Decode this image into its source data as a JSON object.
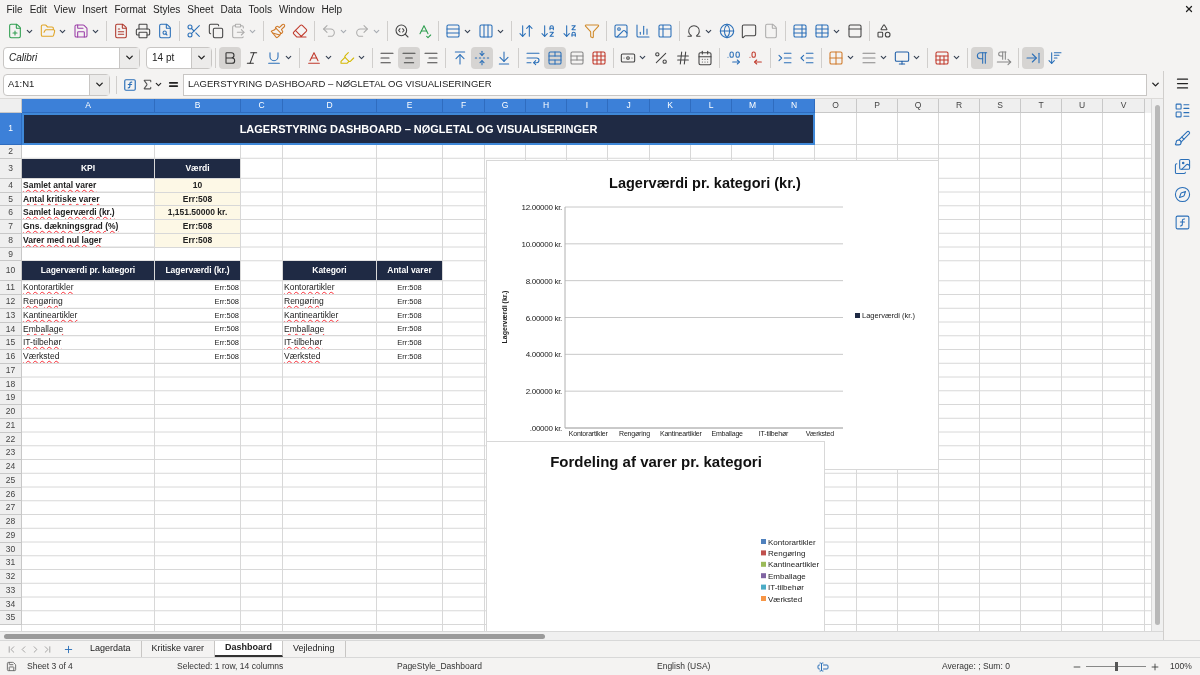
{
  "menu": [
    "File",
    "Edit",
    "View",
    "Insert",
    "Format",
    "Styles",
    "Sheet",
    "Data",
    "Tools",
    "Window",
    "Help"
  ],
  "standard_toolbar": [
    [
      {
        "kind": "new",
        "disabled": false
      },
      {
        "kind": "open",
        "disabled": false
      },
      {
        "kind": "save",
        "disabled": false
      }
    ],
    [
      {
        "kind": "pdf",
        "disabled": false
      },
      {
        "kind": "print",
        "disabled": false
      },
      {
        "kind": "preview",
        "disabled": false
      }
    ],
    [
      {
        "kind": "cut",
        "disabled": false
      },
      {
        "kind": "copy",
        "disabled": false
      },
      {
        "kind": "paste",
        "disabled": true
      }
    ],
    [
      {
        "kind": "clone",
        "disabled": false
      },
      {
        "kind": "clear",
        "disabled": false
      }
    ],
    [
      {
        "kind": "undo",
        "disabled": true
      },
      {
        "kind": "redo",
        "disabled": true
      }
    ],
    [
      {
        "kind": "find",
        "disabled": false
      },
      {
        "kind": "spelling",
        "disabled": false
      }
    ],
    [
      {
        "kind": "row",
        "disabled": false
      },
      {
        "kind": "column",
        "disabled": false
      }
    ],
    [
      {
        "kind": "sort",
        "disabled": false
      },
      {
        "kind": "sortasc",
        "disabled": false
      },
      {
        "kind": "sortdesc",
        "disabled": false
      },
      {
        "kind": "filter",
        "disabled": false
      }
    ],
    [
      {
        "kind": "image",
        "disabled": false
      },
      {
        "kind": "chart",
        "disabled": false
      },
      {
        "kind": "pivot",
        "disabled": false
      }
    ],
    [
      {
        "kind": "special",
        "disabled": false
      },
      {
        "kind": "hyperlink",
        "disabled": false
      },
      {
        "kind": "comment",
        "disabled": false
      },
      {
        "kind": "header",
        "disabled": true
      }
    ],
    [
      {
        "kind": "printrange",
        "disabled": false
      },
      {
        "kind": "freeze",
        "disabled": false
      },
      {
        "kind": "split",
        "disabled": false
      }
    ],
    [
      {
        "kind": "shapes",
        "disabled": false
      }
    ]
  ],
  "format_toolbar": {
    "font": "Calibri",
    "size": "14 pt",
    "groups": [
      [
        {
          "kind": "bold",
          "on": true
        },
        {
          "kind": "italic",
          "on": false
        },
        {
          "kind": "underline",
          "on": false
        }
      ],
      [
        {
          "kind": "fontcolor",
          "on": false
        },
        {
          "kind": "highlight",
          "on": false
        }
      ],
      [
        {
          "kind": "left",
          "on": false
        },
        {
          "kind": "center",
          "on": true
        },
        {
          "kind": "right",
          "on": false
        }
      ],
      [
        {
          "kind": "top",
          "on": false
        },
        {
          "kind": "vcenter",
          "on": true
        },
        {
          "kind": "bottom",
          "on": false
        }
      ],
      [
        {
          "kind": "wrap",
          "on": false
        },
        {
          "kind": "merge",
          "on": true
        },
        {
          "kind": "unmerge",
          "on": false
        },
        {
          "kind": "delmerge",
          "on": false
        }
      ],
      [
        {
          "kind": "currency",
          "on": false
        },
        {
          "kind": "percent",
          "on": false
        },
        {
          "kind": "number",
          "on": false
        },
        {
          "kind": "date",
          "on": false
        }
      ],
      [
        {
          "kind": "adddec",
          "on": false
        },
        {
          "kind": "deldec",
          "on": false
        }
      ],
      [
        {
          "kind": "indent",
          "on": false
        },
        {
          "kind": "outdent",
          "on": false
        }
      ],
      [
        {
          "kind": "borders",
          "on": false
        },
        {
          "kind": "borderstyle",
          "on": false
        },
        {
          "kind": "bordercolor",
          "on": false
        }
      ],
      [
        {
          "kind": "conditional",
          "on": false
        }
      ],
      [
        {
          "kind": "ltr",
          "on": true
        },
        {
          "kind": "rtl",
          "on": false
        }
      ],
      [
        {
          "kind": "stacked",
          "on": true
        },
        {
          "kind": "vertical",
          "on": false
        }
      ]
    ]
  },
  "formula_bar": {
    "name_box": "A1:N1",
    "content": "LAGERSTYRING DASHBOARD – NØGLETAL OG VISUALISERINGER"
  },
  "columns": [
    {
      "label": "A",
      "selected": true
    },
    {
      "label": "B",
      "selected": true
    },
    {
      "label": "C",
      "selected": true
    },
    {
      "label": "D",
      "selected": true
    },
    {
      "label": "E",
      "selected": true
    },
    {
      "label": "F",
      "selected": true
    },
    {
      "label": "G",
      "selected": true
    },
    {
      "label": "H",
      "selected": true
    },
    {
      "label": "I",
      "selected": true
    },
    {
      "label": "J",
      "selected": true
    },
    {
      "label": "K",
      "selected": true
    },
    {
      "label": "L",
      "selected": true
    },
    {
      "label": "M",
      "selected": true
    },
    {
      "label": "N",
      "selected": true
    },
    {
      "label": "O",
      "selected": false
    },
    {
      "label": "P",
      "selected": false
    },
    {
      "label": "Q",
      "selected": false
    },
    {
      "label": "R",
      "selected": false
    },
    {
      "label": "S",
      "selected": false
    },
    {
      "label": "T",
      "selected": false
    },
    {
      "label": "U",
      "selected": false
    },
    {
      "label": "V",
      "selected": false
    }
  ],
  "rows": [
    {
      "label": "1",
      "selected": true
    },
    {
      "label": "2",
      "selected": false
    },
    {
      "label": "3",
      "selected": false
    },
    {
      "label": "4",
      "selected": false
    },
    {
      "label": "5",
      "selected": false
    },
    {
      "label": "6",
      "selected": false
    },
    {
      "label": "7",
      "selected": false
    },
    {
      "label": "8",
      "selected": false
    },
    {
      "label": "9",
      "selected": false
    },
    {
      "label": "10",
      "selected": false
    },
    {
      "label": "11",
      "selected": false
    },
    {
      "label": "12",
      "selected": false
    },
    {
      "label": "13",
      "selected": false
    },
    {
      "label": "14",
      "selected": false
    },
    {
      "label": "15",
      "selected": false
    },
    {
      "label": "16",
      "selected": false
    },
    {
      "label": "17",
      "selected": false
    },
    {
      "label": "18",
      "selected": false
    },
    {
      "label": "19",
      "selected": false
    },
    {
      "label": "20",
      "selected": false
    },
    {
      "label": "21",
      "selected": false
    },
    {
      "label": "22",
      "selected": false
    },
    {
      "label": "23",
      "selected": false
    },
    {
      "label": "24",
      "selected": false
    },
    {
      "label": "25",
      "selected": false
    },
    {
      "label": "26",
      "selected": false
    },
    {
      "label": "27",
      "selected": false
    },
    {
      "label": "28",
      "selected": false
    },
    {
      "label": "29",
      "selected": false
    },
    {
      "label": "30",
      "selected": false
    },
    {
      "label": "31",
      "selected": false
    },
    {
      "label": "32",
      "selected": false
    },
    {
      "label": "33",
      "selected": false
    },
    {
      "label": "34",
      "selected": false
    },
    {
      "label": "35",
      "selected": false
    }
  ],
  "title": "LAGERSTYRING DASHBOARD – NØGLETAL OG VISUALISERINGER",
  "kpi_table": {
    "columns": [
      "KPI",
      "Værdi"
    ],
    "rows": [
      {
        "label": "Samlet antal varer",
        "value": "10",
        "spell_error": true
      },
      {
        "label": "Antal kritiske varer",
        "value": "Err:508",
        "spell_error": true
      },
      {
        "label": "Samlet lagerværdi (kr.)",
        "value": "1,151.50000 kr.",
        "spell_error": true
      },
      {
        "label": "Gns. dækningsgrad (%)",
        "value": "Err:508",
        "spell_error": true
      },
      {
        "label": "Varer med nul lager",
        "value": "Err:508",
        "spell_error": true
      }
    ]
  },
  "value_table": {
    "columns": [
      "Lagerværdi pr. kategori",
      "Lagerværdi (kr.)"
    ],
    "rows": [
      {
        "label": "Kontorartikler",
        "value": "Err:508",
        "spell_error": true
      },
      {
        "label": "Rengøring",
        "value": "Err:508",
        "spell_error": true
      },
      {
        "label": "Kantineartikler",
        "value": "Err:508",
        "spell_error": true
      },
      {
        "label": "Emballage",
        "value": "Err:508",
        "spell_error": true
      },
      {
        "label": "IT-tilbehør",
        "value": "Err:508",
        "spell_error": true
      },
      {
        "label": "Værksted",
        "value": "Err:508",
        "spell_error": true
      }
    ]
  },
  "count_table": {
    "columns": [
      "Kategori",
      "Antal varer"
    ],
    "rows": [
      {
        "label": "Kontorartikler",
        "value": "Err:508",
        "spell_error": true
      },
      {
        "label": "Rengøring",
        "value": "Err:508",
        "spell_error": true
      },
      {
        "label": "Kantineartikler",
        "value": "Err:508",
        "spell_error": true
      },
      {
        "label": "Emballage",
        "value": "Err:508",
        "spell_error": true
      },
      {
        "label": "IT-tilbehør",
        "value": "Err:508",
        "spell_error": true
      },
      {
        "label": "Værksted",
        "value": "Err:508",
        "spell_error": true
      }
    ]
  },
  "value_chart": {
    "chart_data": {
      "type": "bar",
      "title": "Lagerværdi pr. kategori (kr.)",
      "ylabel": "Lagerværdi (kr.)",
      "categories": [
        "Kontorartikler",
        "Rengøring",
        "Kantineartikler",
        "Emballage",
        "IT-tilbehør",
        "Værksted"
      ],
      "series": [
        {
          "name": "Lagerværdi (kr.)",
          "color": "#1f2a44",
          "values": [
            null,
            null,
            null,
            null,
            null,
            null
          ]
        }
      ],
      "ylim": [
        0,
        12
      ],
      "grid": true,
      "yticks": [
        {
          "value": 0,
          "label": ".00000 kr."
        },
        {
          "value": 2,
          "label": "2.00000 kr."
        },
        {
          "value": 4,
          "label": "4.00000 kr."
        },
        {
          "value": 6,
          "label": "6.00000 kr."
        },
        {
          "value": 8,
          "label": "8.00000 kr."
        },
        {
          "value": 10,
          "label": "10.00000 kr."
        },
        {
          "value": 12,
          "label": "12.00000 kr."
        }
      ]
    }
  },
  "pie_chart": {
    "chart_data": {
      "type": "pie",
      "title": "Fordeling af varer pr. kategori"
    },
    "legend": [
      {
        "label": "Kontorartikler",
        "color": "#4f81bd"
      },
      {
        "label": "Rengøring",
        "color": "#c0504d"
      },
      {
        "label": "Kantineartikler",
        "color": "#9bbb59"
      },
      {
        "label": "Emballage",
        "color": "#8064a2"
      },
      {
        "label": "IT-tilbehør",
        "color": "#4bacc6"
      },
      {
        "label": "Værksted",
        "color": "#f79646"
      }
    ]
  },
  "sheet_tabs": [
    {
      "label": "Lagerdata",
      "selected": false
    },
    {
      "label": "Kritiske varer",
      "selected": false
    },
    {
      "label": "Dashboard",
      "selected": true
    },
    {
      "label": "Vejledning",
      "selected": false
    }
  ],
  "status_bar": {
    "sheet": "Sheet 3 of 4",
    "selection": "Selected: 1 row, 14 columns",
    "page_style": "PageStyle_Dashboard",
    "language": "English (USA)",
    "sum": "Average: ; Sum: 0",
    "zoom": {
      "level": 0.5,
      "reading": "100%"
    }
  }
}
